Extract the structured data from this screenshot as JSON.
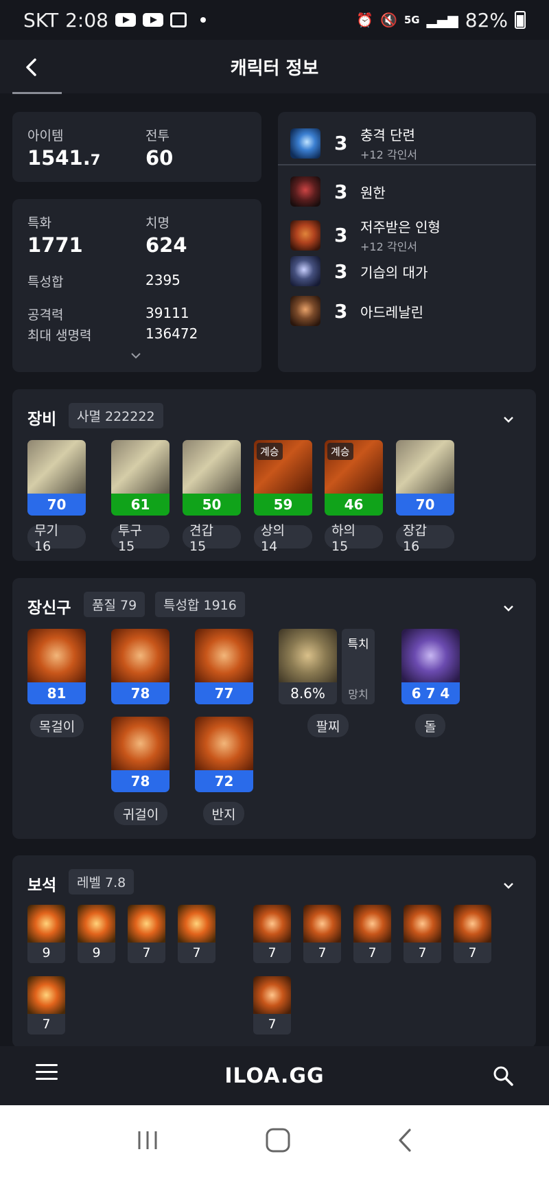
{
  "status_bar": {
    "carrier": "SKT",
    "time": "2:08",
    "network": "5G",
    "battery": "82%"
  },
  "header": {
    "title": "캐릭터 정보"
  },
  "stats": {
    "item_label": "아이템",
    "item_level_main": "1541.",
    "item_level_decimal": "7",
    "combat_label": "전투",
    "combat_level": "60",
    "spec_label": "특화",
    "spec_value": "1771",
    "crit_label": "치명",
    "crit_value": "624",
    "sum_label": "특성합",
    "sum_value": "2395",
    "attack_label": "공격력",
    "attack_value": "39111",
    "hp_label": "최대 생명력",
    "hp_value": "136472"
  },
  "engravings": [
    {
      "level": "3",
      "name": "충격 단련",
      "sub": "+12 각인서",
      "icon_color": "#3b7fd1"
    },
    {
      "level": "3",
      "name": "원한",
      "sub": "",
      "icon_color": "#7a2b2b"
    },
    {
      "level": "3",
      "name": "저주받은 인형",
      "sub": "+12 각인서",
      "icon_color": "#b0421e"
    },
    {
      "level": "3",
      "name": "기습의 대가",
      "sub": "",
      "icon_color": "#45507e"
    },
    {
      "level": "3",
      "name": "아드레날린",
      "sub": "",
      "icon_color": "#7a4a2a"
    }
  ],
  "equipment": {
    "title": "장비",
    "set_chip": "사멸 222222",
    "items": [
      {
        "quality": "70",
        "label": "무기 16",
        "tag": ""
      },
      {
        "quality": "61",
        "label": "투구 15",
        "tag": ""
      },
      {
        "quality": "50",
        "label": "견갑 15",
        "tag": ""
      },
      {
        "quality": "59",
        "label": "상의 14",
        "tag": "계승"
      },
      {
        "quality": "46",
        "label": "하의 15",
        "tag": "계승"
      },
      {
        "quality": "70",
        "label": "장갑 16",
        "tag": ""
      }
    ]
  },
  "accessories": {
    "title": "장신구",
    "quality_chip": "품질 79",
    "sum_chip": "특성합 1916",
    "necklace": {
      "quality": "81",
      "label": "목걸이"
    },
    "earring1": {
      "quality": "78"
    },
    "ring1": {
      "quality": "77"
    },
    "earring2": {
      "quality": "78",
      "label": "귀걸이"
    },
    "ring2": {
      "quality": "72",
      "label": "반지"
    },
    "bracelet": {
      "value": "8.6%",
      "stat_top": "특치",
      "stat_bottom": "망치",
      "label": "팔찌"
    },
    "stone": {
      "value": "6 7 4",
      "label": "돌"
    }
  },
  "gems": {
    "title": "보석",
    "level_chip": "레벨 7.8",
    "left_row1": [
      "9",
      "9",
      "7",
      "7"
    ],
    "left_row2": [
      "7"
    ],
    "right_row1": [
      "7",
      "7",
      "7",
      "7",
      "7"
    ],
    "right_row2": [
      "7"
    ]
  },
  "bottom_bar": {
    "logo": "ILOA.GG"
  },
  "colors": {
    "background": "#15171d",
    "card": "#20232b",
    "quality_blue": "#2a6bea",
    "quality_green": "#10a31a"
  }
}
